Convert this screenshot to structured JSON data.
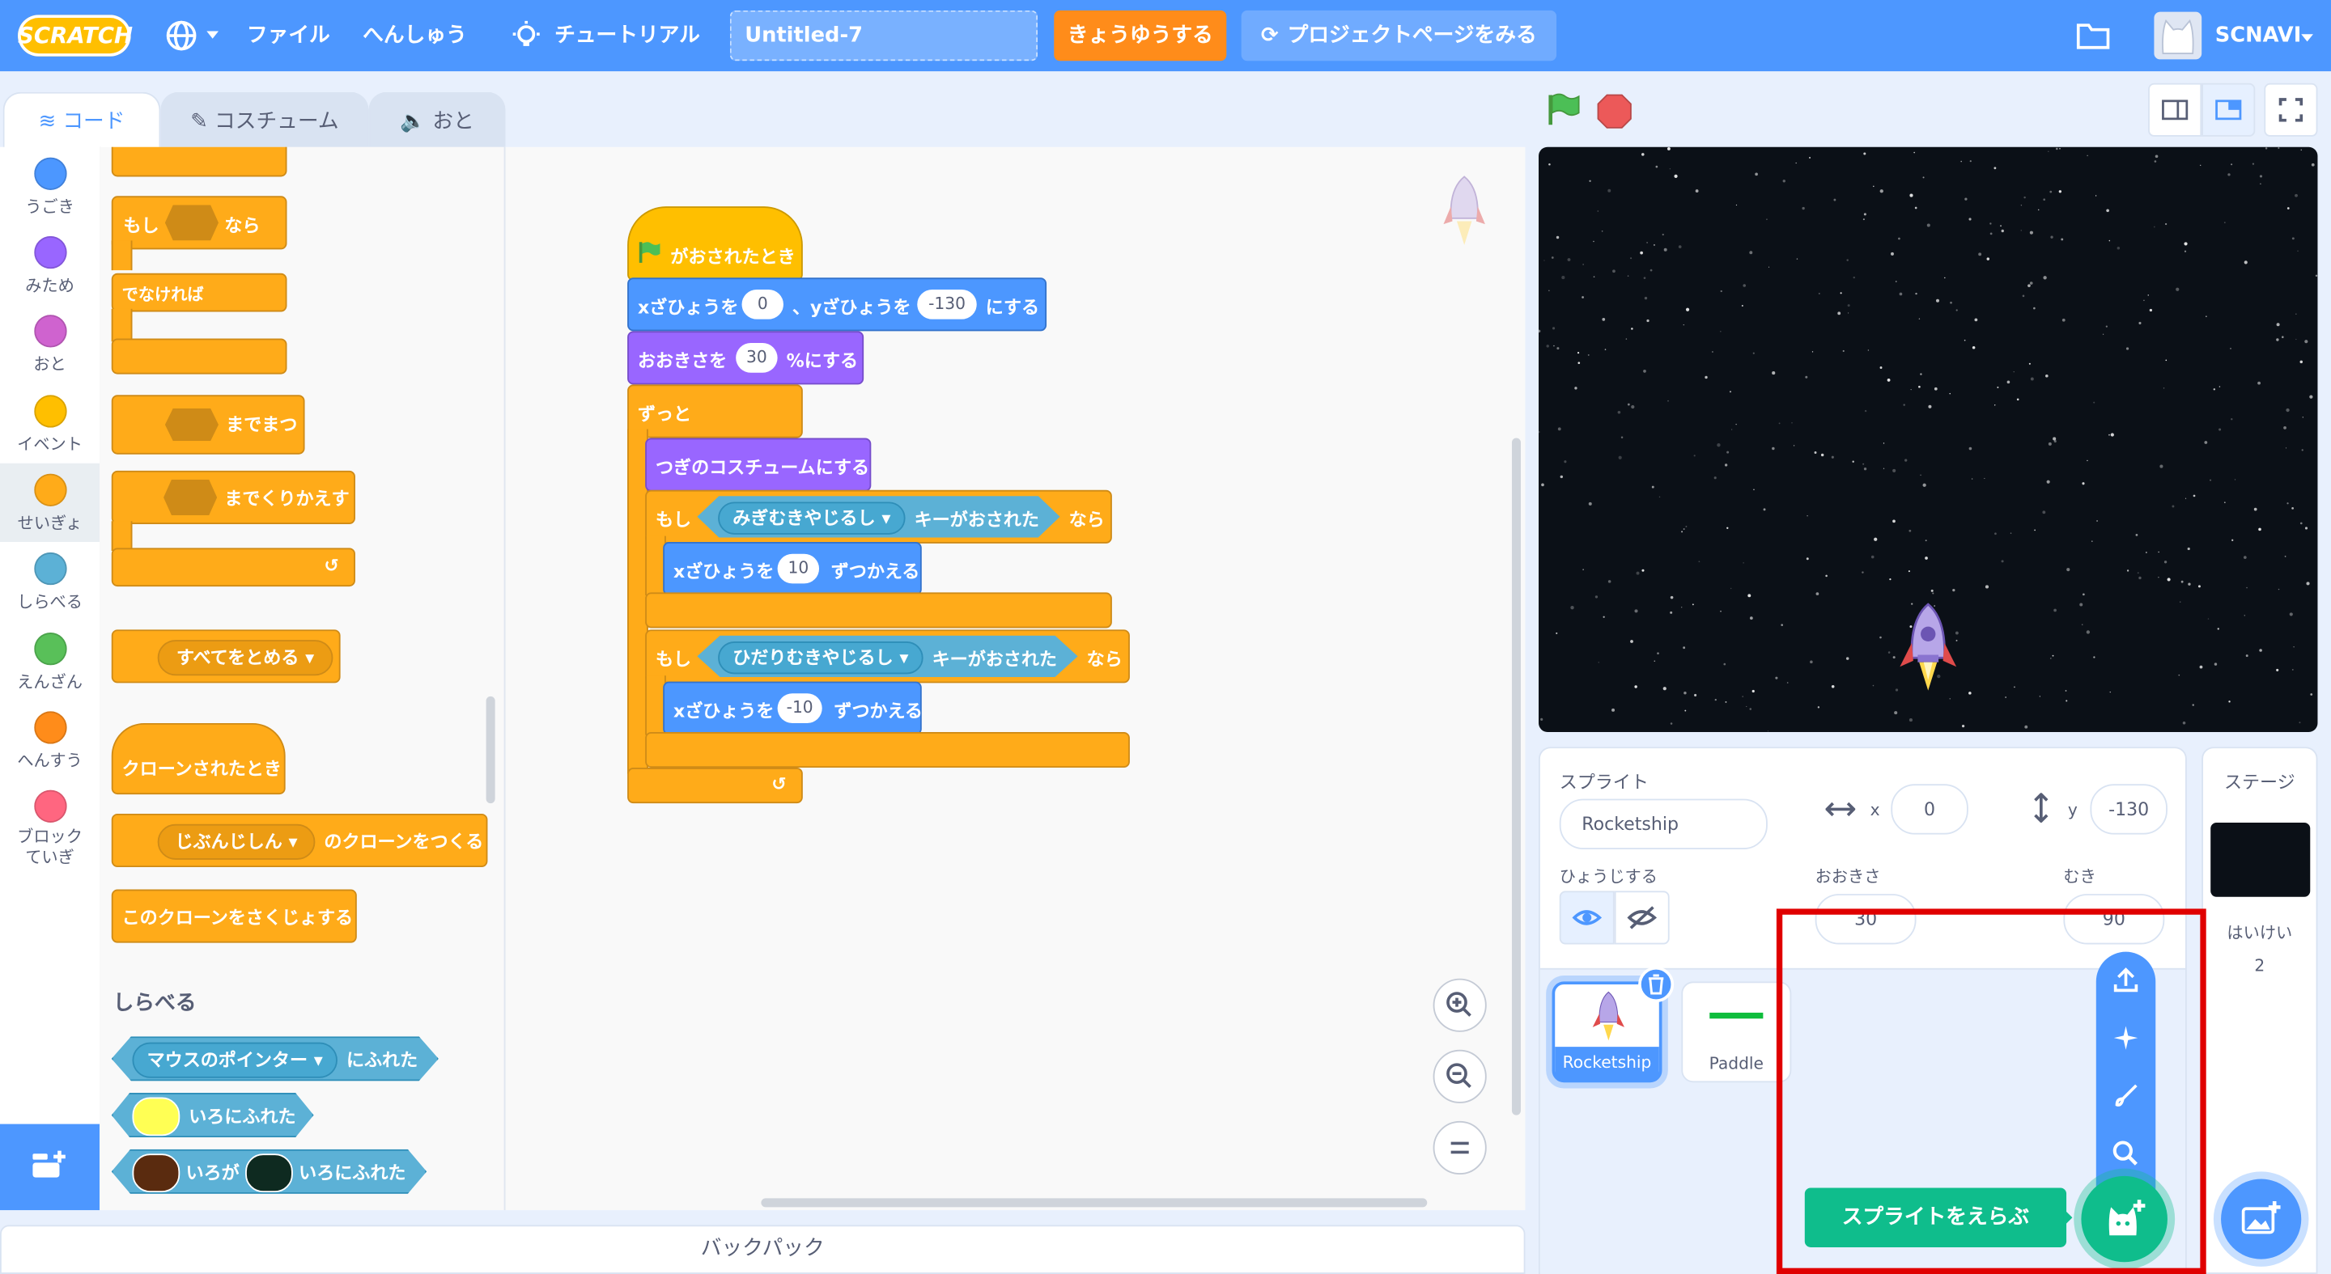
{
  "menu": {
    "logo": "SCRATCH",
    "file": "ファイル",
    "edit": "へんしゅう",
    "tutorial": "チュートリアル",
    "project_title": "Untitled-7",
    "share": "きょうゆうする",
    "project_page": "プロジェクトページをみる",
    "username": "SCNAVI"
  },
  "tabs": {
    "code": "コード",
    "costumes": "コスチューム",
    "sounds": "おと"
  },
  "categories": [
    {
      "label": "うごき",
      "color": "#4c97ff"
    },
    {
      "label": "みため",
      "color": "#9966ff"
    },
    {
      "label": "おと",
      "color": "#cf63cf"
    },
    {
      "label": "イベント",
      "color": "#ffbf00"
    },
    {
      "label": "せいぎょ",
      "color": "#ffab19"
    },
    {
      "label": "しらべる",
      "color": "#5cb1d6"
    },
    {
      "label": "えんざん",
      "color": "#59c059"
    },
    {
      "label": "へんすう",
      "color": "#ff8c1a"
    },
    {
      "label": "ブロックていぎ",
      "color": "#ff6680"
    }
  ],
  "palette": {
    "if_label": "もし",
    "then_label": "なら",
    "else_label": "でなければ",
    "wait_until": "までまつ",
    "repeat_until": "までくりかえす",
    "stop_all": "すべてをとめる",
    "clone_start": "クローンされたとき",
    "clone_self": "じぶんじしん",
    "create_clone": "のクローンをつくる",
    "delete_clone": "このクローンをさくじょする",
    "sensing_header": "しらべる",
    "mouse_pointer": "マウスのポインター",
    "touching": "にふれた",
    "touching_color": "いろにふれた",
    "color_is": "いろが",
    "touching_color2": "いろにふれた"
  },
  "script": {
    "flag_clicked": "がおされたとき",
    "goto_x": "xざひょうを",
    "x_val": "0",
    "goto_y": "、yざひょうを",
    "y_val": "-130",
    "goto_end": "にする",
    "size_label": "おおきさを",
    "size_val": "30",
    "size_end": "%にする",
    "forever": "ずっと",
    "next_costume": "つぎのコスチュームにする",
    "if1": "もし",
    "key_right": "みぎむきやじるし",
    "key_pressed": "キーがおされた",
    "then1": "なら",
    "change_x": "xざひょうを",
    "dx1": "10",
    "change_end": "ずつかえる",
    "if2": "もし",
    "key_left": "ひだりむきやじるし",
    "key_pressed2": "キーがおされた",
    "then2": "なら",
    "change_x2": "xざひょうを",
    "dx2": "-10",
    "change_end2": "ずつかえる"
  },
  "backpack": "バックパック",
  "sprite_info": {
    "sprite_label": "スプライト",
    "sprite_name": "Rocketship",
    "x_label": "x",
    "x": "0",
    "y_label": "y",
    "y": "-130",
    "show_label": "ひょうじする",
    "size_label": "おおきさ",
    "size": "30",
    "direction_label": "むき",
    "direction": "90"
  },
  "sprites": [
    {
      "name": "Rocketship",
      "selected": true
    },
    {
      "name": "Paddle",
      "selected": false
    }
  ],
  "choose_sprite_tooltip": "スプライトをえらぶ",
  "stage_panel": {
    "title": "ステージ",
    "backdrops_label": "はいけい",
    "backdrops_count": "2"
  },
  "colors": {
    "menu_bar": "#4d97ff",
    "share_button": "#ff8c1a",
    "sprite_button": "#0fbd8c",
    "highlight_box": "#e00000"
  }
}
